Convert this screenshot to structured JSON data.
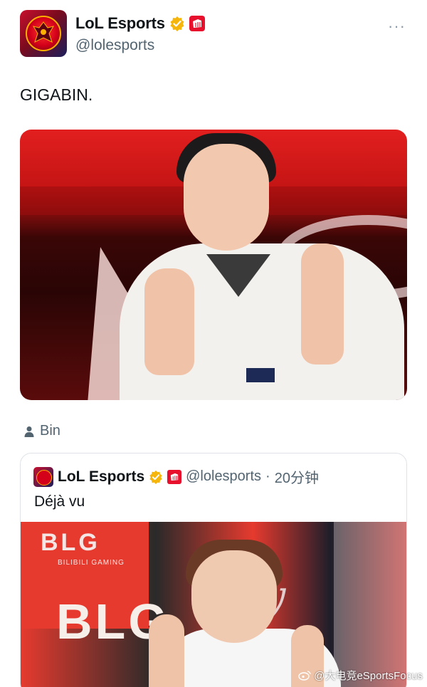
{
  "tweet": {
    "author": {
      "display_name": "LoL Esports",
      "handle": "@lolesports",
      "verified_icon": "verified-gold-badge",
      "affiliate_icon": "riot-fist-icon"
    },
    "more_icon": "···",
    "text": "GIGABIN.",
    "media_icon": "photo",
    "tagged_user_icon": "person-icon",
    "tagged_user": "Bin"
  },
  "quoted_tweet": {
    "author": {
      "display_name": "LoL Esports",
      "handle": "@lolesports",
      "verified_icon": "verified-gold-badge",
      "affiliate_icon": "riot-fist-icon"
    },
    "separator": "·",
    "time": "20分钟",
    "text": "Déjà vu",
    "media_icon": "photo",
    "banner_text": "BLG",
    "banner_subtext": "BILIBILI GAMING",
    "big_text": "BLG"
  },
  "watermark": "@大电竞eSportsFocus",
  "colors": {
    "accent_red": "#e8112d",
    "verified_gold": "#f5b50a",
    "muted": "#536471"
  }
}
